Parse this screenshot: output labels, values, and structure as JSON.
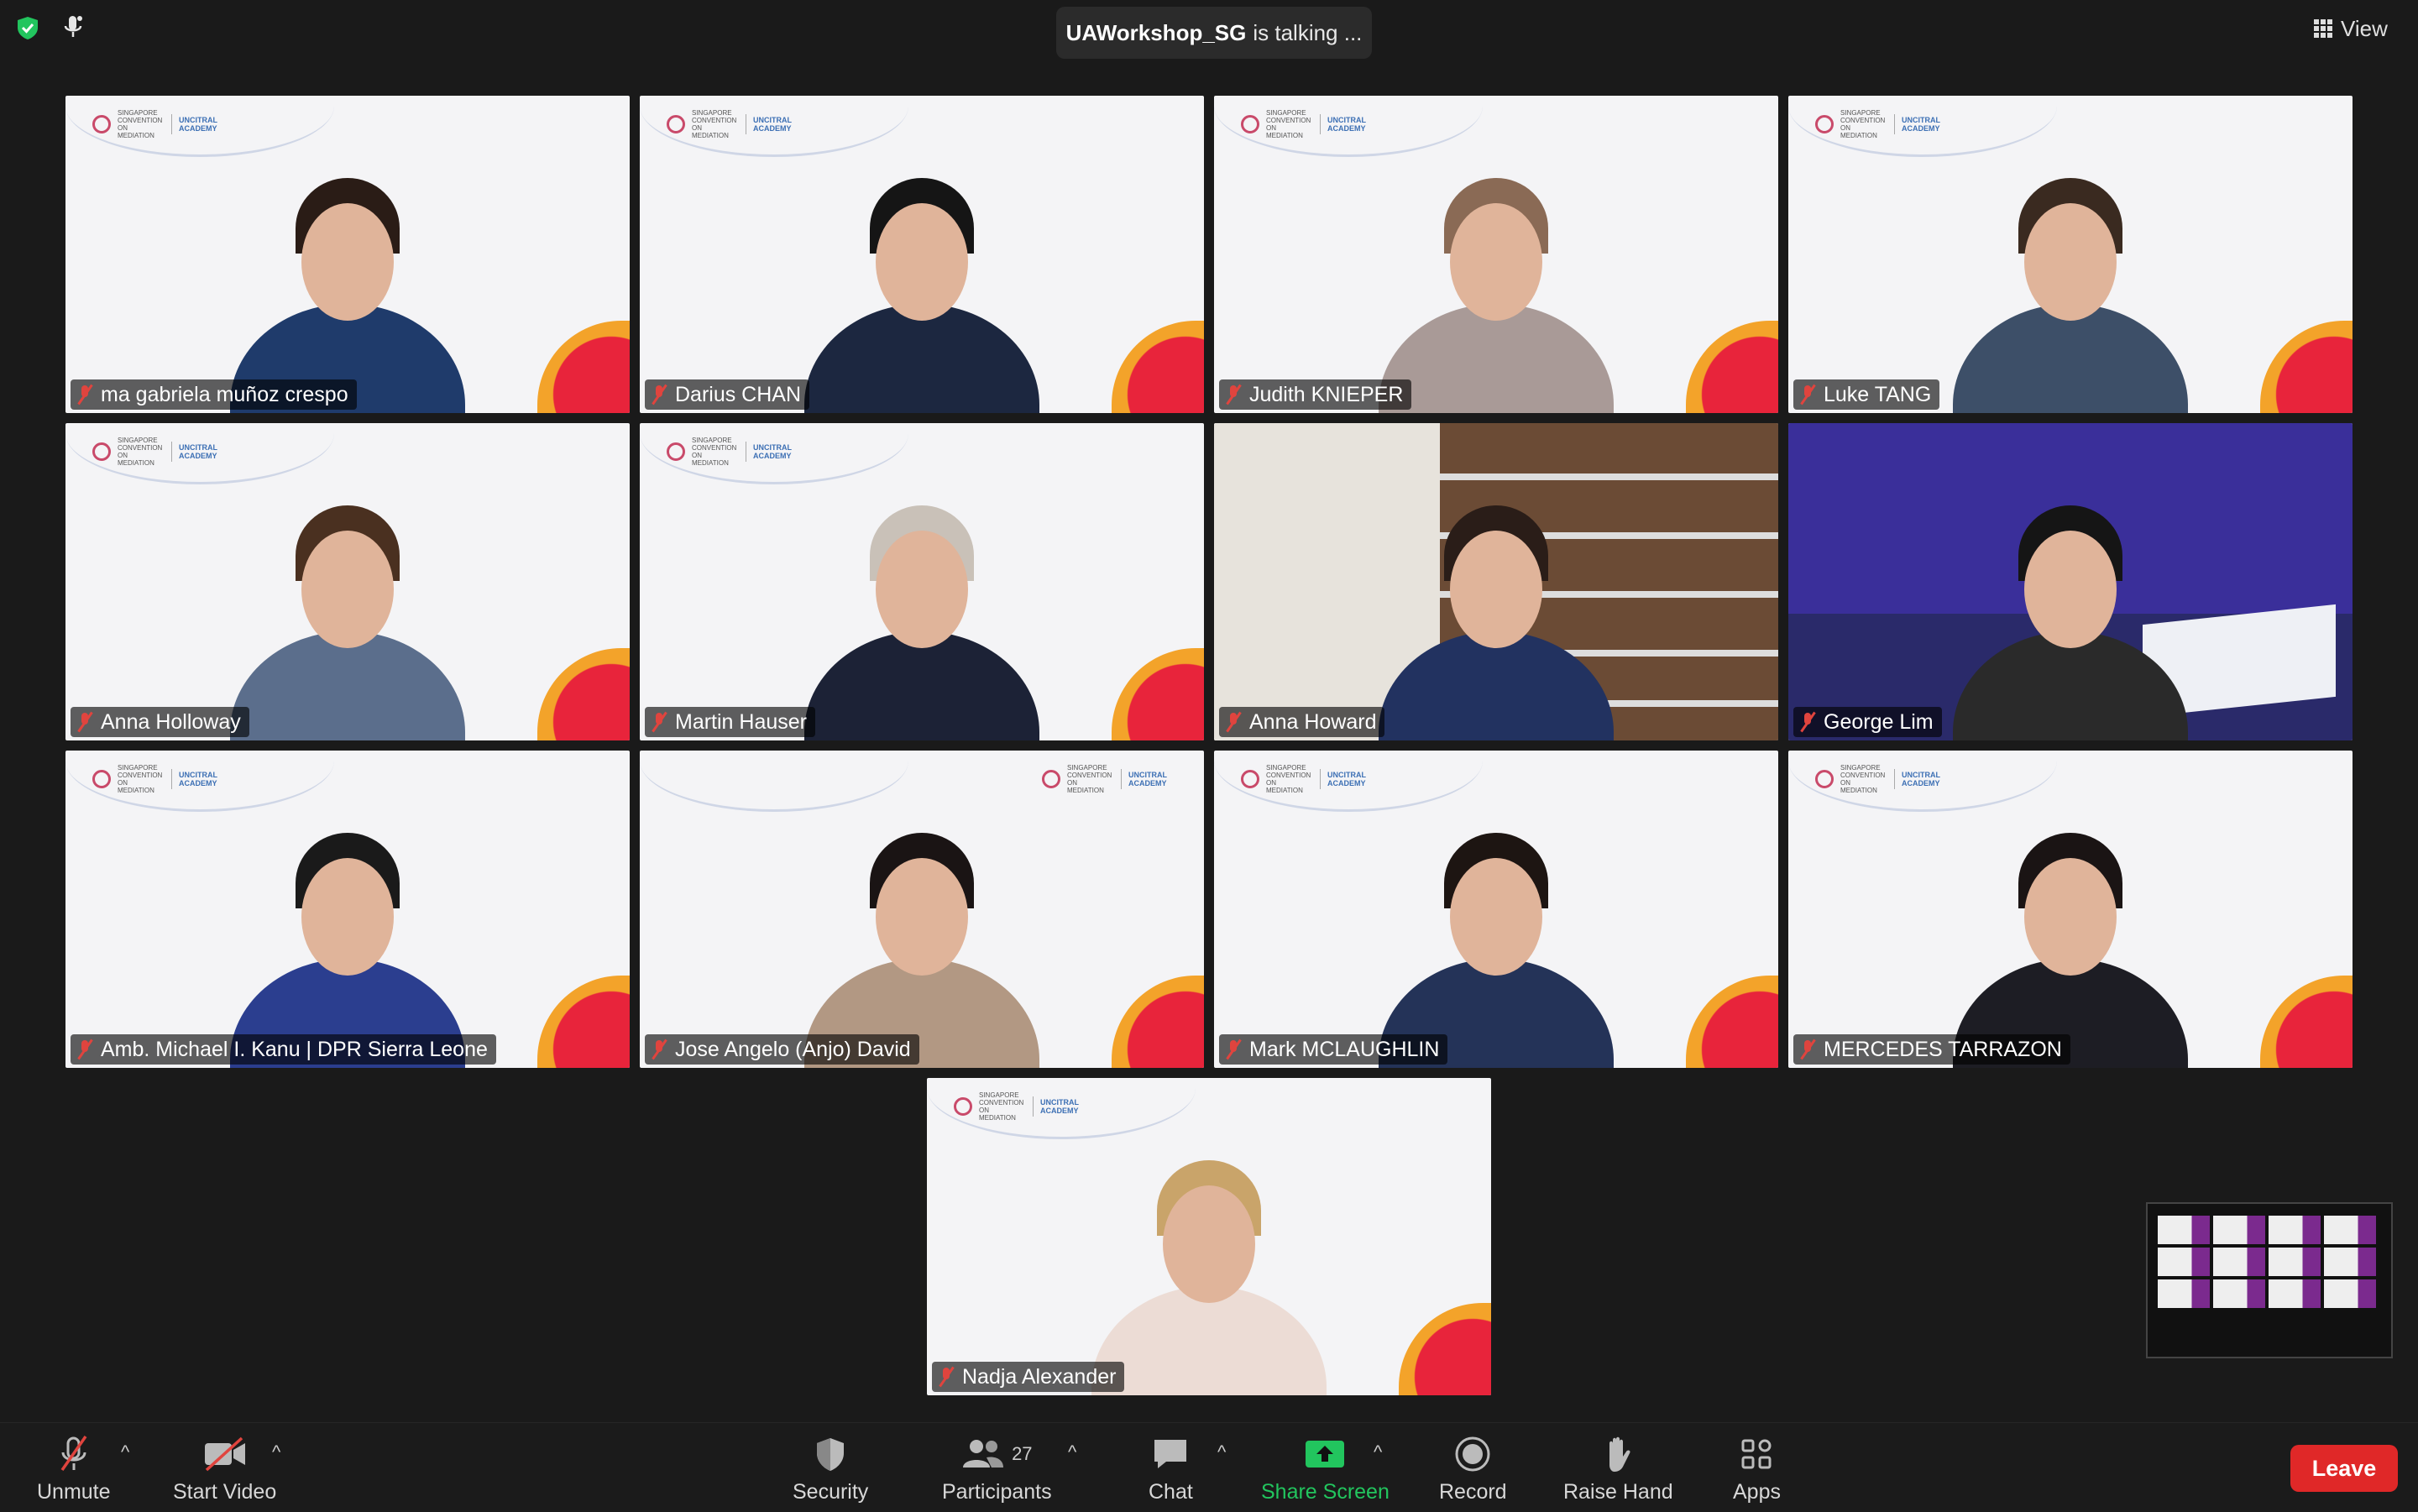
{
  "topbar": {
    "talking_name": "UAWorkshop_SG",
    "talking_suffix": "is talking ...",
    "view_label": "View"
  },
  "participants": [
    {
      "name": "ma gabriela muñoz crespo",
      "bg": "branded",
      "shirt": "#1f3b6b",
      "hair": "#2a1c16"
    },
    {
      "name": "Darius CHAN",
      "bg": "branded",
      "shirt": "#1c2740",
      "hair": "#151515"
    },
    {
      "name": "Judith KNIEPER",
      "bg": "branded",
      "shirt": "#a99a97",
      "hair": "#8a6a55"
    },
    {
      "name": "Luke TANG",
      "bg": "branded",
      "shirt": "#3d4f68",
      "hair": "#3a2a20"
    },
    {
      "name": "Anna Holloway",
      "bg": "branded",
      "shirt": "#5b6e8c",
      "hair": "#4a3020"
    },
    {
      "name": "Martin Hauser",
      "bg": "branded",
      "shirt": "#1c2236",
      "hair": "#c9c1b8"
    },
    {
      "name": "Anna Howard",
      "bg": "room",
      "shirt": "#223260",
      "hair": "#2a1d18"
    },
    {
      "name": "George Lim",
      "bg": "stage",
      "shirt": "#2a2a2a",
      "hair": "#151515"
    },
    {
      "name": "Amb. Michael I. Kanu | DPR Sierra Leone",
      "bg": "branded",
      "shirt": "#2b3e8f",
      "hair": "#1a1a1a"
    },
    {
      "name": "Jose Angelo (Anjo) David",
      "bg": "branded-alt",
      "shirt": "#b29883",
      "hair": "#1a1414"
    },
    {
      "name": "Mark MCLAUGHLIN",
      "bg": "branded",
      "shirt": "#243358",
      "hair": "#1d1512"
    },
    {
      "name": "MERCEDES TARRAZON",
      "bg": "branded",
      "shirt": "#1d1d24",
      "hair": "#1a1414"
    },
    {
      "name": "Nadja Alexander",
      "bg": "branded",
      "shirt": "#ecdcd5",
      "hair": "#c9a46a"
    }
  ],
  "logo": {
    "left_text": "SINGAPORE CONVENTION ON MEDIATION",
    "right_text": "UNCITRAL ACADEMY"
  },
  "toolbar": {
    "unmute": "Unmute",
    "start_video": "Start Video",
    "security": "Security",
    "participants": "Participants",
    "participants_count": "27",
    "chat": "Chat",
    "share_screen": "Share Screen",
    "record": "Record",
    "raise_hand": "Raise Hand",
    "apps": "Apps",
    "leave": "Leave"
  },
  "colors": {
    "brand_purple": "#7b2a8e",
    "share_green": "#22c55e",
    "leave_red": "#e02828",
    "muted_red": "#e0443e"
  }
}
